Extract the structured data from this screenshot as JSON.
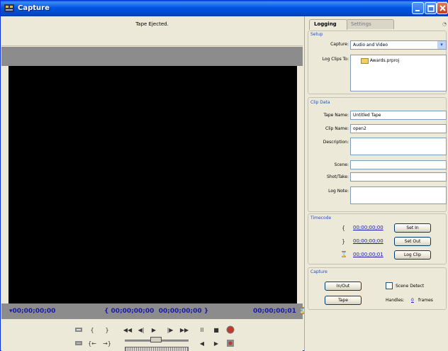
{
  "window": {
    "title": "Capture"
  },
  "monitor": {
    "status": "Tape Ejected.",
    "timecode_current": "00;00;00;00",
    "timecode_in": "{ 00;00;00;00",
    "timecode_out": "00;00;00;00 }",
    "timecode_duration": "00;00;00;01",
    "controls": {
      "set_in": "{",
      "set_out": "}",
      "goto_in": "{←",
      "goto_out": "→}",
      "rewind": "◀◀",
      "step_back": "◀|",
      "play": "▶",
      "step_fwd": "|▶",
      "fast_fwd": "▶▶",
      "pause": "II",
      "stop": "■",
      "shuttle_left": "◀",
      "shuttle_right": "▶"
    }
  },
  "panel": {
    "tabs": [
      {
        "label": "Logging",
        "active": true
      },
      {
        "label": "Settings",
        "active": false
      }
    ],
    "setup": {
      "title": "Setup",
      "capture_label": "Capture:",
      "capture_value": "Audio and Video",
      "log_clips_label": "Log Clips To:",
      "log_clips_value": "Awards.prproj"
    },
    "clip_data": {
      "title": "Clip Data",
      "tape_name_label": "Tape Name:",
      "tape_name_value": "Untitled Tape",
      "clip_name_label": "Clip Name:",
      "clip_name_value": "open2",
      "description_label": "Description:",
      "description_value": "",
      "scene_label": "Scene:",
      "scene_value": "",
      "shot_label": "Shot/Take:",
      "shot_value": "",
      "log_note_label": "Log Note:",
      "log_note_value": ""
    },
    "timecode": {
      "title": "Timecode",
      "in_bracket": "{",
      "out_bracket": "}",
      "in_value": "00;00;00;00",
      "out_value": "00;00;00;00",
      "duration_value": "00;00;00;01",
      "set_in_label": "Set In",
      "set_out_label": "Set Out",
      "log_clip_label": "Log Clip"
    },
    "capture": {
      "title": "Capture",
      "in_out_label": "In/Out",
      "tape_label": "Tape",
      "scene_detect_label": "Scene Detect",
      "handles_label": "Handles:",
      "handles_value": "0",
      "frames_label": "frames"
    }
  },
  "colors": {
    "titlebar": "#0054e3",
    "timecode_text": "#1a1aa8",
    "section_title": "#2a4fae",
    "video_bg": "#000000"
  }
}
